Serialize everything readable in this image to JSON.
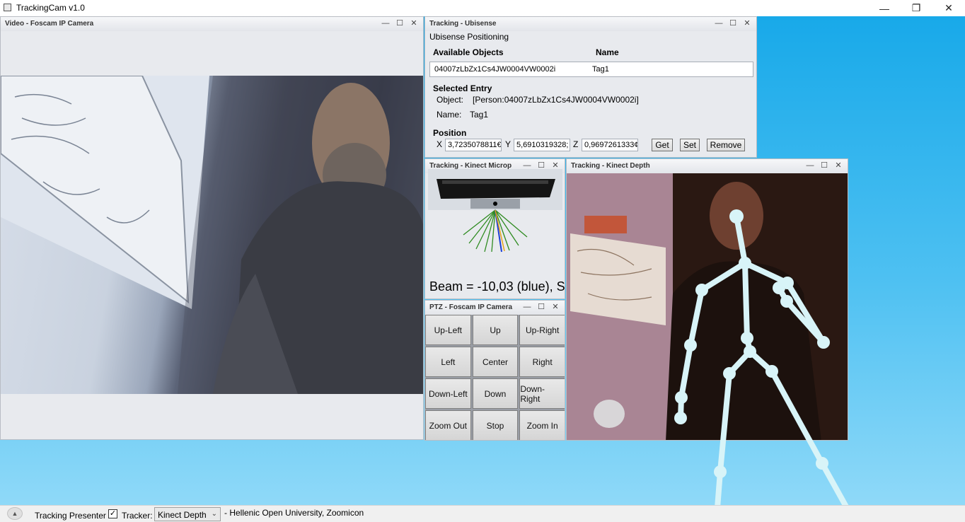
{
  "app": {
    "title": "TrackingCam v1.0",
    "buttons": {
      "minimize": "—",
      "restore": "❐",
      "close": "✕"
    }
  },
  "windows": {
    "video": {
      "title": "Video - Foscam IP Camera"
    },
    "ubisense": {
      "title": "Tracking - Ubisense",
      "subtitle": "Ubisense Positioning",
      "col_available": "Available Objects",
      "col_name": "Name",
      "rows": [
        {
          "id": "04007zLbZx1Cs4JW0004VW0002i",
          "name": "Tag1"
        }
      ],
      "selected_heading": "Selected Entry",
      "object_label": "Object:",
      "object_value": "[Person:04007zLbZx1Cs4JW0004VW0002i]",
      "name_label": "Name:",
      "name_value": "Tag1",
      "position_heading": "Position",
      "x_label": "X",
      "x_value": "3,7235078811€",
      "y_label": "Y",
      "y_value": "5,6910319328;",
      "z_label": "Z",
      "z_value": "0,9697261333¢",
      "get_btn": "Get",
      "set_btn": "Set",
      "remove_btn": "Remove"
    },
    "kinect_mic": {
      "title": "Tracking - Kinect Microp",
      "beam_text": "Beam = -10,03 (blue), Sc"
    },
    "ptz": {
      "title": "PTZ - Foscam IP Camera",
      "buttons": [
        "Up-Left",
        "Up",
        "Up-Right",
        "Left",
        "Center",
        "Right",
        "Down-Left",
        "Down",
        "Down-Right",
        "Zoom Out",
        "Stop",
        "Zoom In"
      ]
    },
    "kinect_depth": {
      "title": "Tracking - Kinect Depth"
    }
  },
  "statusbar": {
    "presenter_label": "Tracking Presenter",
    "tracker_label": "Tracker:",
    "tracker_value": "Kinect Depth",
    "credit": "- Hellenic Open University, Zoomicon"
  },
  "icons": [
    "minimize-icon",
    "restore-icon",
    "close-icon",
    "checkbox-icon",
    "chevron-down-icon",
    "expand-up-icon"
  ],
  "colors": {
    "desktop_top": "#18a9e9",
    "desktop_bottom": "#8fd9f8",
    "skeleton": "#d8f4f8"
  }
}
